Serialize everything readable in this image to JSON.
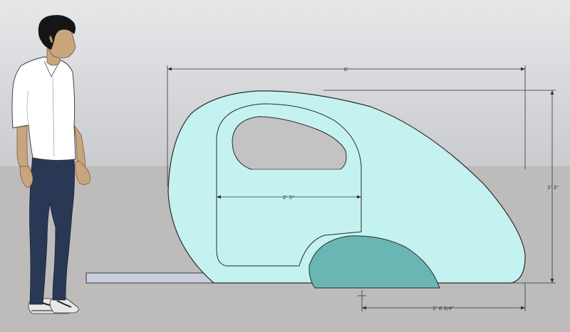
{
  "dimensions": {
    "overall_length": "6'",
    "overall_height": "3' 3\"",
    "door_width": "2' 5\"",
    "wheel_offset": "2' 8 3/4\""
  },
  "colors": {
    "sky_top": "#e6e7e9",
    "sky_bottom": "#c9cbce",
    "ground": "#bdbcba",
    "body_fill": "#c4f2f0",
    "body_stroke": "#2a2a2a",
    "window_fill": "#c3c3c3",
    "fender_fill": "#6ab6b4",
    "hitch_fill": "#c9cfe0",
    "dimension_line": "#333333",
    "shirt": "#ffffff",
    "pants": "#293955",
    "skin": "#c8a57d",
    "hair": "#151515"
  }
}
